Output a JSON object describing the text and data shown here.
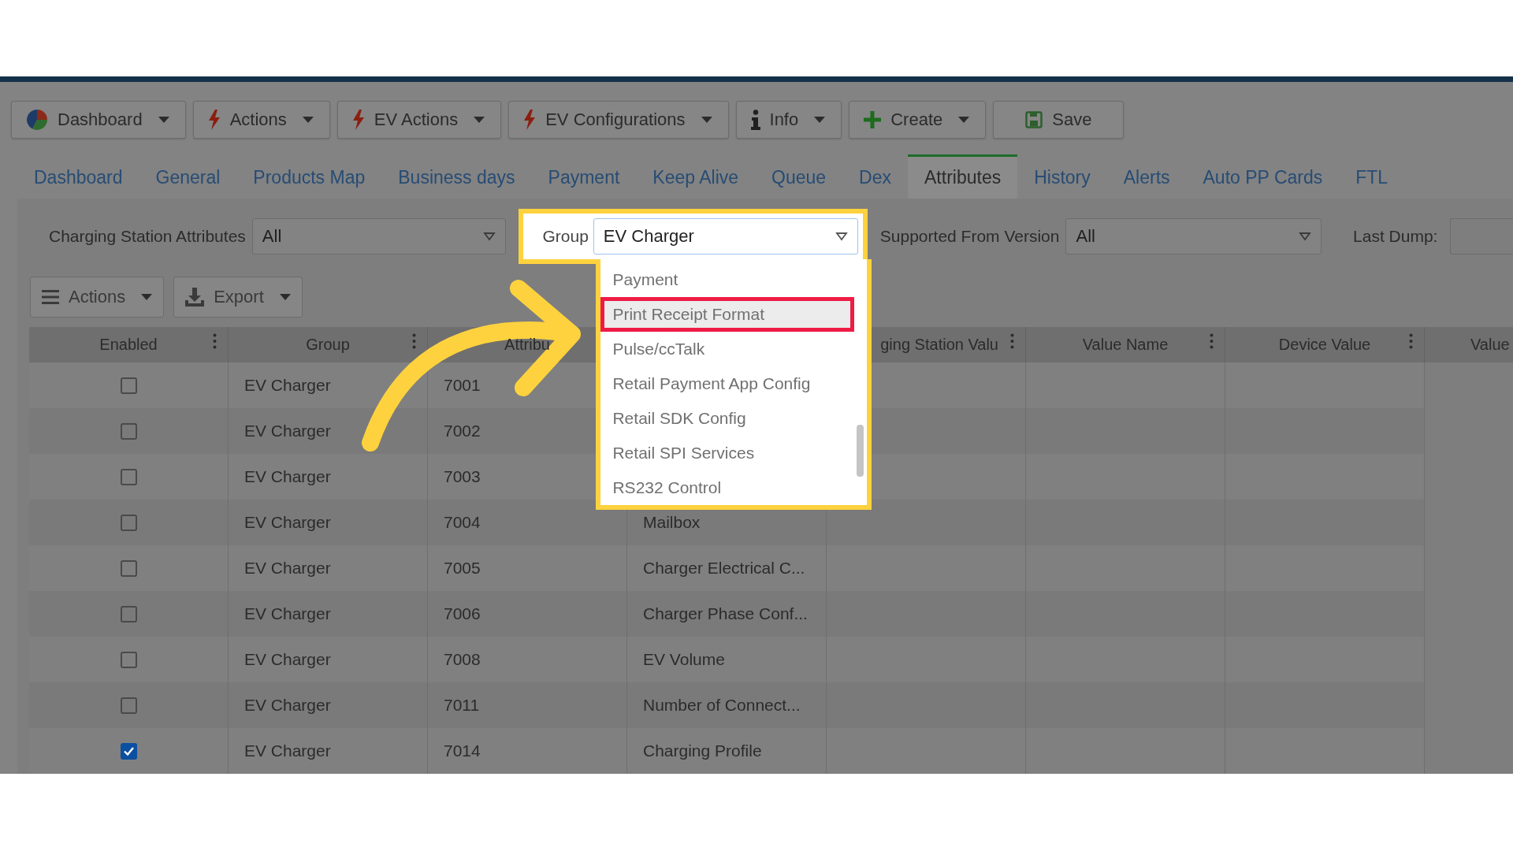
{
  "toolbar": [
    {
      "label": "Dashboard",
      "kind": "dashboard"
    },
    {
      "label": "Actions",
      "kind": "bolt"
    },
    {
      "label": "EV Actions",
      "kind": "bolt"
    },
    {
      "label": "EV Configurations",
      "kind": "bolt"
    },
    {
      "label": "Info",
      "kind": "info"
    },
    {
      "label": "Create",
      "kind": "plus"
    },
    {
      "label": "Save",
      "kind": "save"
    }
  ],
  "tabs": [
    {
      "label": "Dashboard",
      "selected": false
    },
    {
      "label": "General",
      "selected": false
    },
    {
      "label": "Products Map",
      "selected": false
    },
    {
      "label": "Business days",
      "selected": false
    },
    {
      "label": "Payment",
      "selected": false
    },
    {
      "label": "Keep Alive",
      "selected": false
    },
    {
      "label": "Queue",
      "selected": false
    },
    {
      "label": "Dex",
      "selected": false
    },
    {
      "label": "Attributes",
      "selected": true
    },
    {
      "label": "History",
      "selected": false
    },
    {
      "label": "Alerts",
      "selected": false
    },
    {
      "label": "Auto PP Cards",
      "selected": false
    },
    {
      "label": "FTL",
      "selected": false
    }
  ],
  "filters": {
    "attributes": {
      "label": "Charging Station Attributes",
      "value": "All"
    },
    "group": {
      "label": "Group",
      "value": "EV Charger",
      "options": [
        {
          "label": "Payment",
          "selected": false
        },
        {
          "label": "Print Receipt Format",
          "selected": true
        },
        {
          "label": "Pulse/ccTalk",
          "selected": false
        },
        {
          "label": "Retail Payment App Config",
          "selected": false
        },
        {
          "label": "Retail SDK Config",
          "selected": false
        },
        {
          "label": "Retail SPI Services",
          "selected": false
        },
        {
          "label": "RS232 Control",
          "selected": false
        }
      ]
    },
    "version": {
      "label": "Supported From Version",
      "value": "All"
    },
    "last_dump": {
      "label": "Last Dump:"
    }
  },
  "grid_actions": [
    {
      "label": "Actions",
      "kind": "menu"
    },
    {
      "label": "Export",
      "kind": "export"
    }
  ],
  "table": {
    "columns": [
      "Enabled",
      "Group",
      "Attribu",
      null,
      "ging Station Valu",
      "Value Name",
      "Device Value",
      "Value"
    ],
    "rows": [
      {
        "enabled": false,
        "group": "EV Charger",
        "id": "7001"
      },
      {
        "enabled": false,
        "group": "EV Charger",
        "id": "7002"
      },
      {
        "enabled": false,
        "group": "EV Charger",
        "id": "7003"
      },
      {
        "enabled": false,
        "group": "EV Charger",
        "id": "7004",
        "column_4": "Mailbox"
      },
      {
        "enabled": false,
        "group": "EV Charger",
        "id": "7005",
        "column_4": "Charger Electrical C..."
      },
      {
        "enabled": false,
        "group": "EV Charger",
        "id": "7006",
        "column_4": "Charger Phase Conf..."
      },
      {
        "enabled": false,
        "group": "EV Charger",
        "id": "7008",
        "column_4": "EV Volume"
      },
      {
        "enabled": false,
        "group": "EV Charger",
        "id": "7011",
        "column_4": "Number of Connect..."
      },
      {
        "enabled": true,
        "group": "EV Charger",
        "id": "7014",
        "column_4": "Charging Profile"
      }
    ]
  }
}
